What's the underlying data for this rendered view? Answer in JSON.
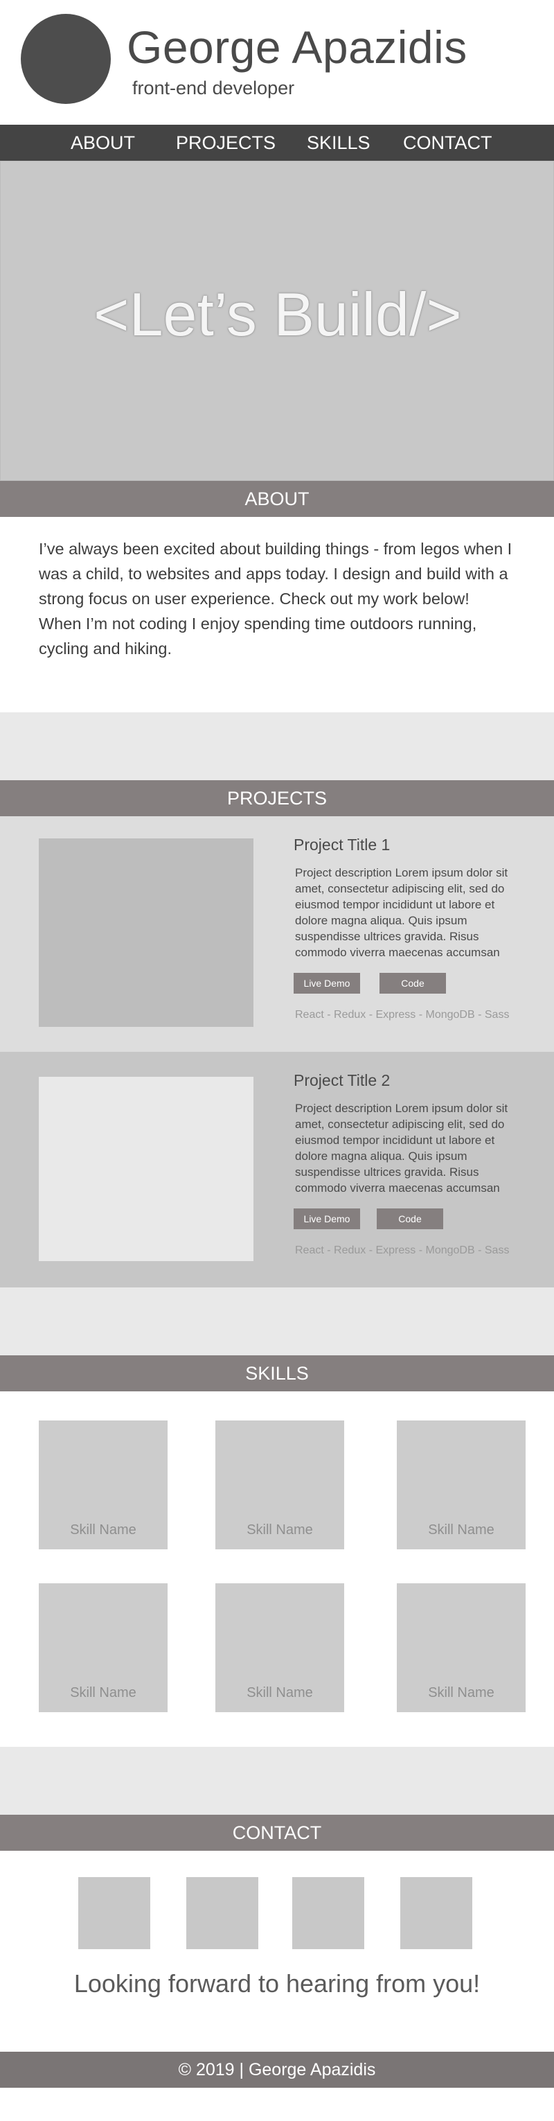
{
  "header": {
    "name": "George Apazidis",
    "role": "front-end developer"
  },
  "nav": {
    "items": [
      "ABOUT",
      "PROJECTS",
      "SKILLS",
      "CONTACT"
    ]
  },
  "hero": {
    "headline": "<Let’s Build/>"
  },
  "about": {
    "heading": "ABOUT",
    "paragraph1": "I’ve always been excited about building things - from legos when I was a child, to websites and apps today.  I design and build with a strong focus on user experience. Check out my work below!",
    "paragraph2": "When I’m not coding I enjoy spending time outdoors running, cycling and hiking."
  },
  "projects": {
    "heading": "PROJECTS",
    "items": [
      {
        "title": "Project Title 1",
        "description": "Project description Lorem ipsum dolor sit amet, consectetur adipiscing elit, sed do eiusmod tempor incididunt ut labore et dolore magna aliqua. Quis ipsum suspendisse ultrices gravida. Risus commodo viverra maecenas accumsan",
        "live_demo_label": "Live Demo",
        "code_label": "Code",
        "tags": "React  -  Redux - Express  -  MongoDB  - Sass"
      },
      {
        "title": "Project Title 2",
        "description": "Project description Lorem ipsum dolor sit amet, consectetur adipiscing elit, sed do eiusmod tempor incididunt ut labore et dolore magna aliqua. Quis ipsum suspendisse ultrices gravida. Risus commodo viverra maecenas accumsan",
        "live_demo_label": "Live Demo",
        "code_label": "Code",
        "tags": "React  -  Redux - Express  -  MongoDB  - Sass"
      }
    ]
  },
  "skills": {
    "heading": "SKILLS",
    "items": [
      "Skill Name",
      "Skill Name",
      "Skill Name",
      "Skill Name",
      "Skill Name",
      "Skill Name"
    ]
  },
  "contact": {
    "heading": "CONTACT",
    "message": "Looking forward to hearing from you!"
  },
  "footer": {
    "text": "© 2019 | George Apazidis"
  },
  "colors": {
    "nav_bg": "#444444",
    "section_bar": "#857f7f",
    "hero_bg": "#c8c8c8",
    "avatar": "#4d4d4d"
  }
}
